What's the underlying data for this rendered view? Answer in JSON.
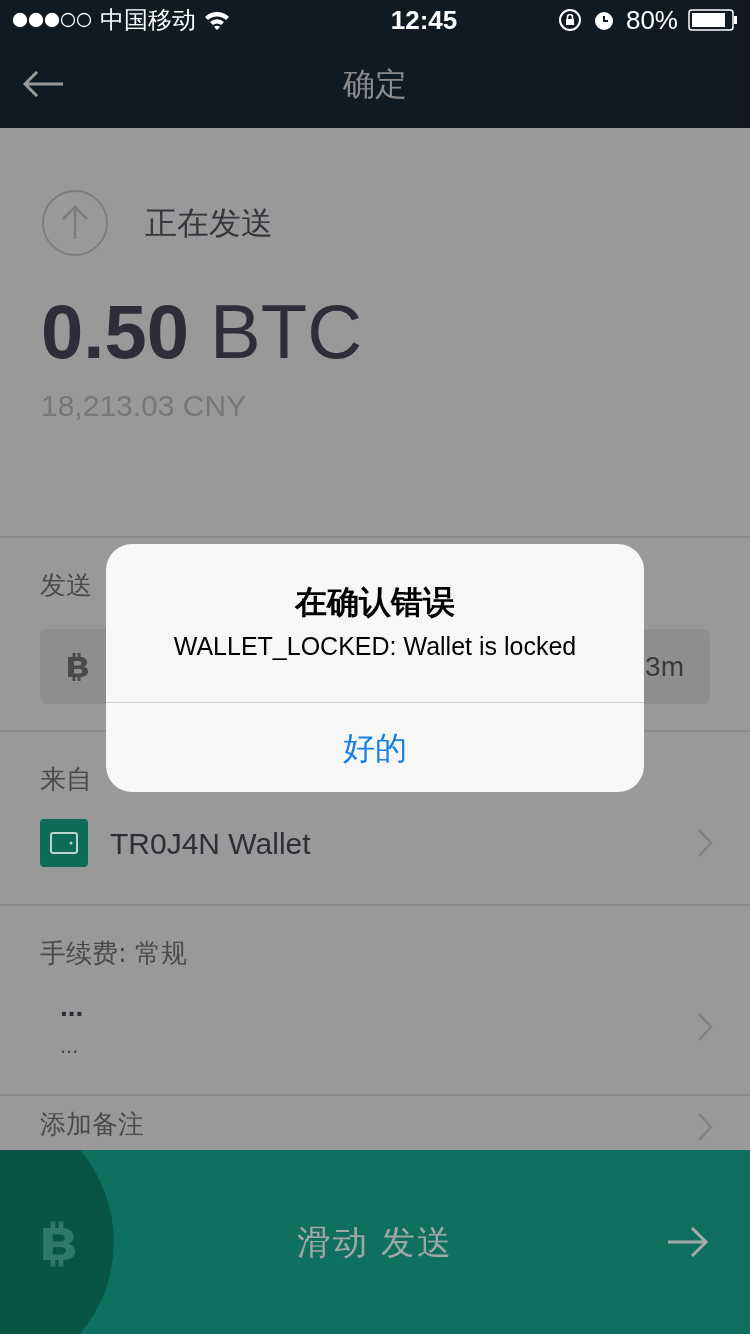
{
  "status_bar": {
    "carrier": "中国移动",
    "time": "12:45",
    "battery": "80%"
  },
  "nav": {
    "title": "确定"
  },
  "sending": {
    "label": "正在发送",
    "amount": "0.50",
    "unit": "BTC",
    "fiat": "18,213.03 CNY"
  },
  "send_to": {
    "label": "发送",
    "address": "3m"
  },
  "from": {
    "label": "来自",
    "wallet": "TR0J4N Wallet"
  },
  "fee": {
    "label": "手续费: 常规",
    "value": "...",
    "detail": "..."
  },
  "note": {
    "label": "添加备注"
  },
  "slider": {
    "label": "滑动 发送"
  },
  "alert": {
    "title": "在确认错误",
    "message": "WALLET_LOCKED: Wallet is locked",
    "button": "好的"
  }
}
